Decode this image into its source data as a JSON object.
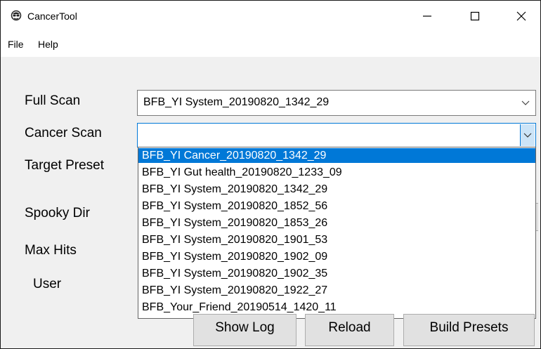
{
  "window": {
    "title": "CancerTool",
    "app_icon": "spy-face-icon",
    "controls": [
      "minimize-icon",
      "maximize-icon",
      "close-icon"
    ]
  },
  "menu": {
    "items": [
      {
        "label": "File"
      },
      {
        "label": "Help"
      }
    ]
  },
  "form": {
    "full_scan_label": "Full Scan",
    "full_scan_value": "BFB_YI System_20190820_1342_29",
    "cancer_scan_label": "Cancer Scan",
    "cancer_scan_value": "",
    "target_preset_label": "Target Preset",
    "spooky_dir_label": "Spooky Dir",
    "max_hits_label": "Max Hits",
    "user_label": "User"
  },
  "dropdown": {
    "selected_index": 0,
    "options": [
      "BFB_YI Cancer_20190820_1342_29",
      "BFB_YI Gut health_20190820_1233_09",
      "BFB_YI System_20190820_1342_29",
      "BFB_YI System_20190820_1852_56",
      "BFB_YI System_20190820_1853_26",
      "BFB_YI System_20190820_1901_53",
      "BFB_YI System_20190820_1902_09",
      "BFB_YI System_20190820_1902_35",
      "BFB_YI System_20190820_1922_27",
      "BFB_Your_Friend_20190514_1420_11"
    ]
  },
  "buttons": {
    "show_log": "Show Log",
    "reload": "Reload",
    "build_presets": "Build Presets"
  },
  "colors": {
    "selection": "#0078d7",
    "focus_border": "#0078d7",
    "window_bg": "#f0f0f0"
  }
}
